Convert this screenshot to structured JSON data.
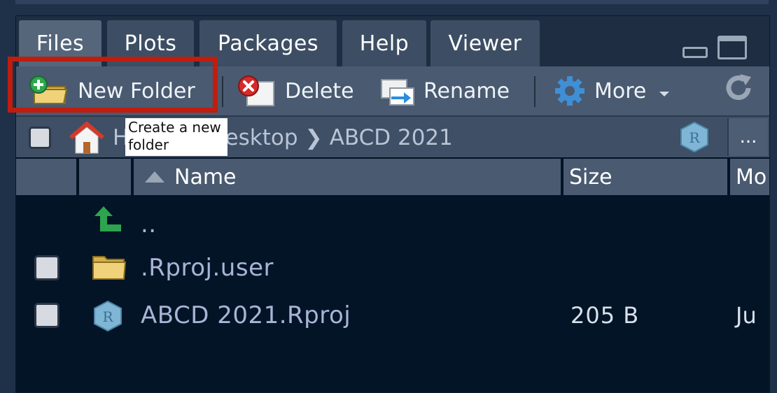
{
  "tabs": [
    {
      "label": "Files",
      "active": true
    },
    {
      "label": "Plots"
    },
    {
      "label": "Packages"
    },
    {
      "label": "Help"
    },
    {
      "label": "Viewer"
    }
  ],
  "toolbar": {
    "new_folder": "New Folder",
    "delete": "Delete",
    "rename": "Rename",
    "more": "More"
  },
  "tooltip": "Create a new folder",
  "breadcrumb": {
    "items": [
      "Home",
      "Desktop",
      "ABCD 2021"
    ],
    "more": "..."
  },
  "table": {
    "columns": {
      "name": "Name",
      "size": "Size",
      "modified": "Mo"
    },
    "rows": [
      {
        "name": "..",
        "icon": "up-arrow-icon",
        "size": "",
        "modified": ""
      },
      {
        "name": ".Rproj.user",
        "icon": "folder-icon",
        "size": "",
        "modified": ""
      },
      {
        "name": "ABCD 2021.Rproj",
        "icon": "rproj-icon",
        "size": "205 B",
        "modified": "Ju"
      }
    ]
  },
  "colors": {
    "highlight": "#c01d0e",
    "background": "#031426",
    "toolbar": "#4a5a70"
  }
}
